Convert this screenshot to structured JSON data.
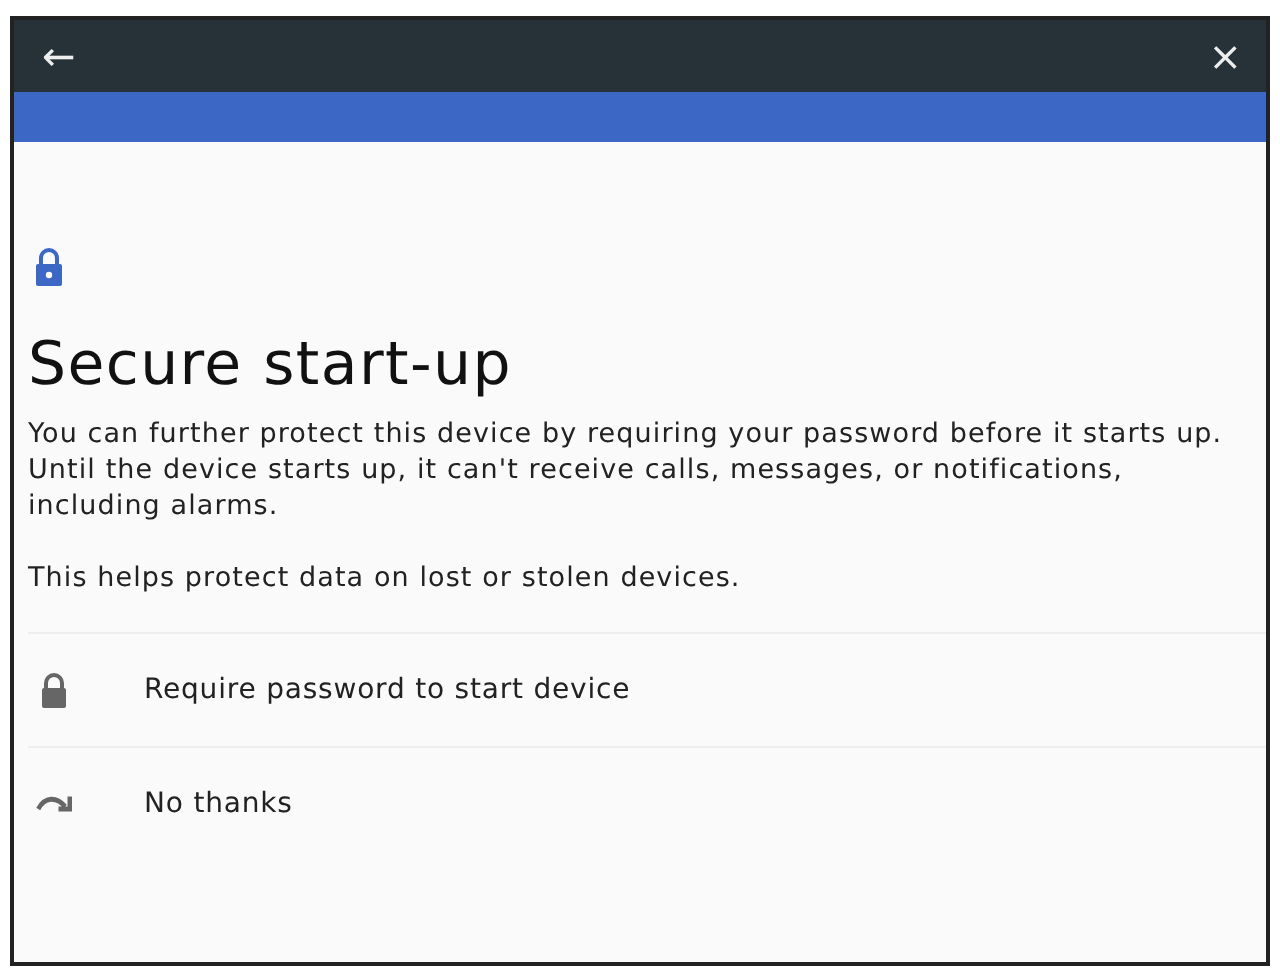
{
  "toolbar": {
    "back": "←",
    "close": "×"
  },
  "header": {
    "title": "Secure start-up"
  },
  "paragraphs": [
    "You can further protect this device by requiring your password before it starts up. Until the device starts up, it can't receive calls, messages, or notifications, including alarms.",
    "This helps protect data on lost or stolen devices."
  ],
  "options": [
    {
      "kind": "lock",
      "label": "Require password to start device"
    },
    {
      "kind": "skip",
      "label": "No thanks"
    }
  ]
}
